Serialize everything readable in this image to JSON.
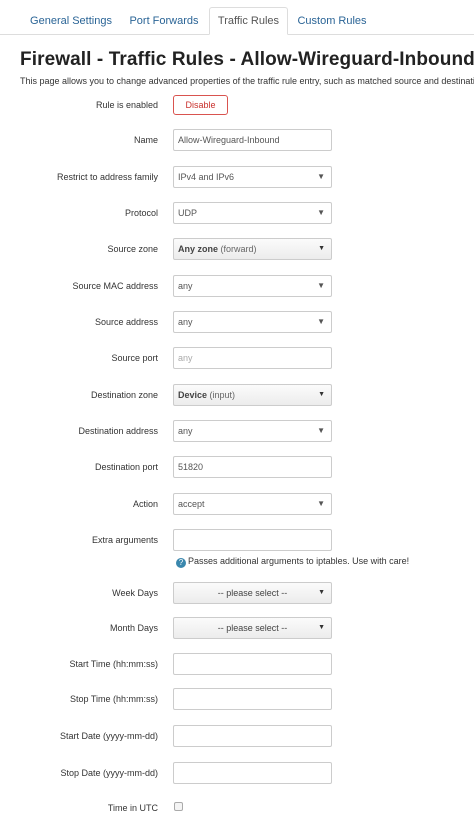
{
  "tabs": [
    "General Settings",
    "Port Forwards",
    "Traffic Rules",
    "Custom Rules"
  ],
  "title": "Firewall - Traffic Rules - Allow-Wireguard-Inbound",
  "description": "This page allows you to change advanced properties of the traffic rule entry, such as matched source and destination hosts.",
  "fields": {
    "enabled": {
      "label": "Rule is enabled",
      "button": "Disable"
    },
    "name": {
      "label": "Name",
      "value": "Allow-Wireguard-Inbound"
    },
    "family": {
      "label": "Restrict to address family",
      "value": "IPv4 and IPv6"
    },
    "protocol": {
      "label": "Protocol",
      "value": "UDP"
    },
    "src_zone": {
      "label": "Source zone",
      "value": "Any zone",
      "sub": "(forward)"
    },
    "src_mac": {
      "label": "Source MAC address",
      "value": "any"
    },
    "src_addr": {
      "label": "Source address",
      "value": "any"
    },
    "src_port": {
      "label": "Source port",
      "placeholder": "any"
    },
    "dest_zone": {
      "label": "Destination zone",
      "value": "Device",
      "sub": "(input)"
    },
    "dest_addr": {
      "label": "Destination address",
      "value": "any"
    },
    "dest_port": {
      "label": "Destination port",
      "value": "51820"
    },
    "action": {
      "label": "Action",
      "value": "accept"
    },
    "extra": {
      "label": "Extra arguments",
      "value": "",
      "help": "Passes additional arguments to iptables. Use with care!"
    },
    "week_days": {
      "label": "Week Days",
      "value": "-- please select --"
    },
    "month_days": {
      "label": "Month Days",
      "value": "-- please select --"
    },
    "start_time": {
      "label": "Start Time (hh:mm:ss)",
      "value": ""
    },
    "stop_time": {
      "label": "Stop Time (hh:mm:ss)",
      "value": ""
    },
    "start_date": {
      "label": "Start Date (yyyy-mm-dd)",
      "value": ""
    },
    "stop_date": {
      "label": "Stop Date (yyyy-mm-dd)",
      "value": ""
    },
    "utc": {
      "label": "Time in UTC",
      "checked": false
    }
  },
  "icons": {
    "select_arrow": "triangle-down-icon",
    "help": "info-icon"
  }
}
